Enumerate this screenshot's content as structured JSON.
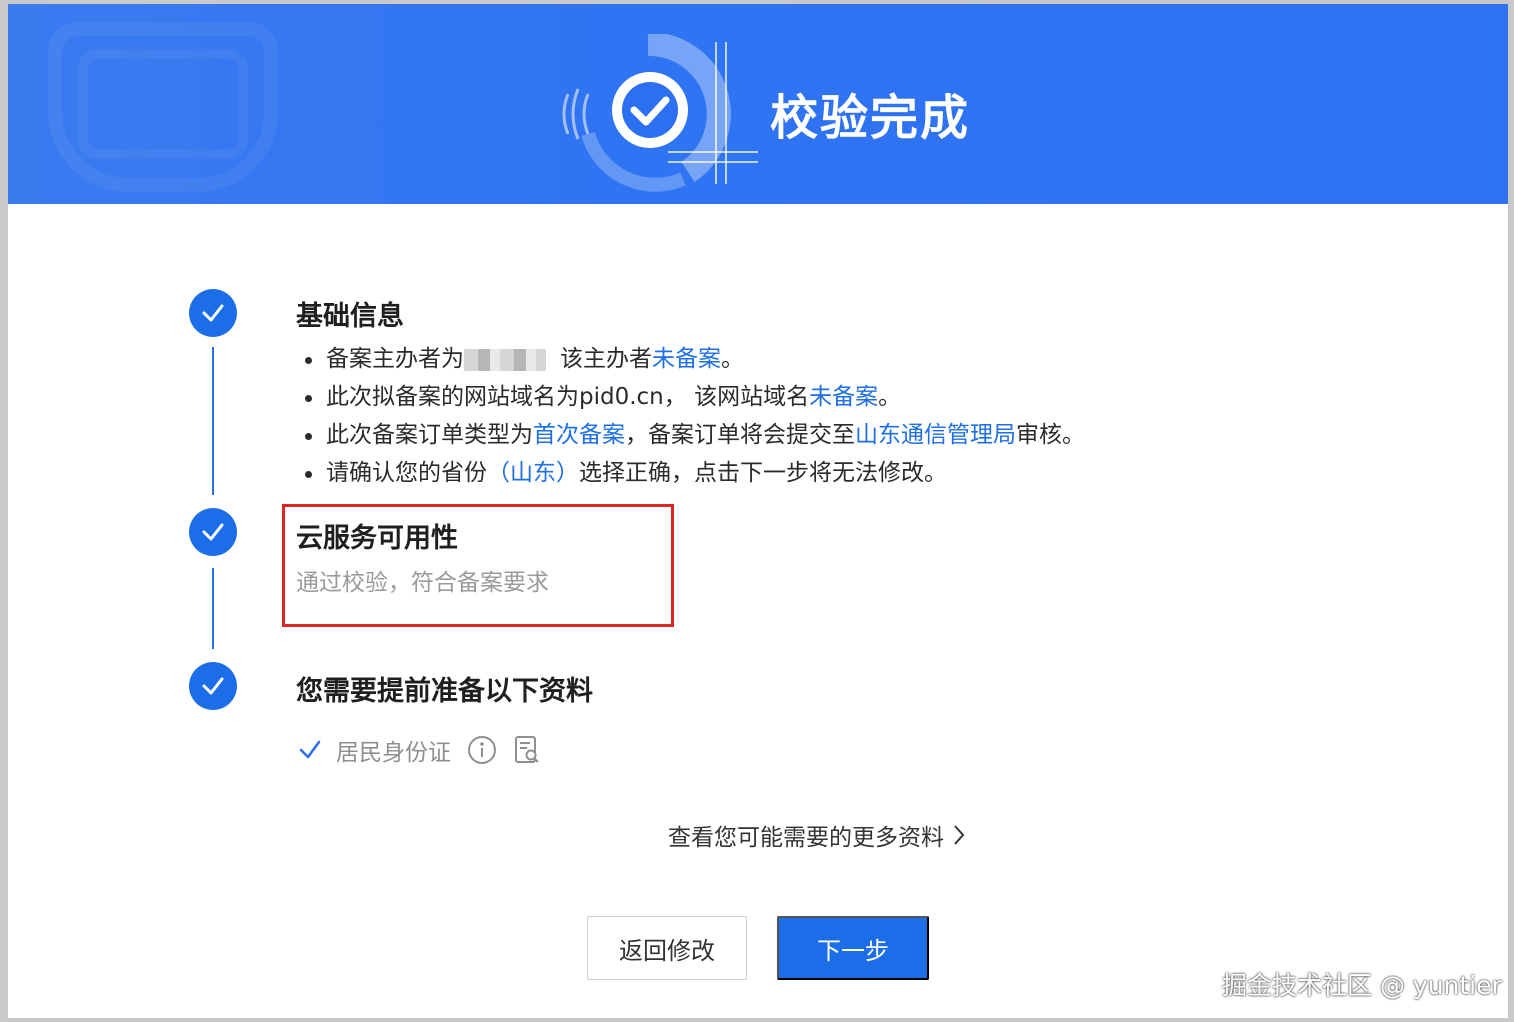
{
  "banner": {
    "title": "校验完成",
    "icon": "check-circle-icon",
    "color": "#2e71f3"
  },
  "steps": [
    {
      "title": "基础信息",
      "icon": "check-icon",
      "bullets": [
        {
          "parts": [
            "备案主办者为",
            "该主办者",
            "未备案",
            "。"
          ]
        },
        {
          "parts": [
            "此次拟备案的网站域名为pid0.cn，  该网站域名",
            "未备案",
            "。"
          ]
        },
        {
          "parts": [
            "此次备案订单类型为",
            "首次备案",
            "，备案订单将会提交至",
            "山东通信管理局",
            "审核。"
          ]
        },
        {
          "parts": [
            "请确认您的省份",
            "（山东）",
            "选择正确，点击下一步将无法修改。"
          ]
        }
      ]
    },
    {
      "title": "云服务可用性",
      "icon": "check-icon",
      "description": "通过校验，符合备案要求"
    },
    {
      "title": "您需要提前准备以下资料",
      "icon": "check-icon",
      "materials": [
        {
          "label": "居民身份证",
          "icons": [
            "info-icon",
            "document-search-icon"
          ]
        }
      ]
    }
  ],
  "more_link": {
    "label": "查看您可能需要的更多资料",
    "icon": "chevron-right-icon"
  },
  "buttons": {
    "back": "返回修改",
    "next": "下一步"
  },
  "watermark": "掘金技术社区 @ yuntier",
  "colors": {
    "primary": "#1c6ee8",
    "link": "#1f6fe5",
    "highlight": "#e02525"
  }
}
